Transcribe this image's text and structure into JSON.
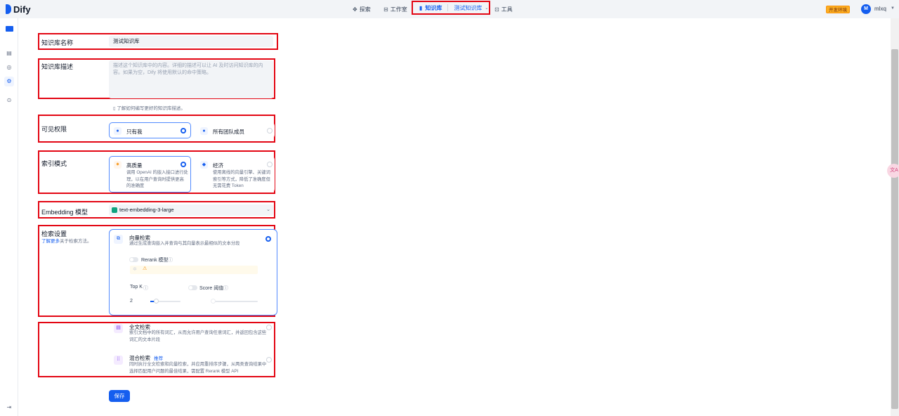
{
  "app": {
    "logo_text": "Dify"
  },
  "nav": {
    "explore": "探索",
    "studio": "工作室",
    "knowledge": "知识库",
    "dataset_name": "测试知识库",
    "tools": "工具"
  },
  "header": {
    "env_badge": "开发环境",
    "avatar_initial": "M",
    "username": "mlxq"
  },
  "form": {
    "name_label": "知识库名称",
    "name_value": "测试知识库",
    "desc_label": "知识库描述",
    "desc_placeholder": "描述这个知识库中的内容。详细的描述可以让 AI 及时访问知识库的内容。如果为空，Dify 将使用默认的命中策略。",
    "desc_hint": "了解如何编写更好的知识库描述。",
    "permission_label": "可见权限",
    "permission_options": [
      "只有我",
      "所有团队成员"
    ],
    "index_label": "索引模式",
    "index_options": [
      {
        "title": "高质量",
        "desc": "调用 OpenAI 的嵌入接口进行处理，以在用户查询时提供更高的准确度"
      },
      {
        "title": "经济",
        "desc": "使用离线的向量引擎、关键词索引等方式，降低了准确度但无需花费 Token"
      }
    ],
    "embedding_label": "Embedding 模型",
    "embedding_value": "text-embedding-3-large",
    "retrieval_label": "检索设置",
    "retrieval_link": "了解更多",
    "retrieval_link_suffix": "关于检索方法。",
    "retrieval_options": [
      {
        "title": "向量检索",
        "desc": "通过生成查询嵌入并查询与其向量表示最相似的文本分段"
      },
      {
        "title": "全文检索",
        "desc": "索引文档中的所有词汇，从而允许用户查询任意词汇，并返回包含这些词汇的文本片段"
      },
      {
        "title": "混合检索",
        "badge": "推荐",
        "desc": "同时执行全文检索和向量检索，并应用重排序步骤，从两类查询结果中选择匹配用户问题的最佳结果，需配置 Rerank 模型 API"
      }
    ],
    "rerank_label": "Rerank 模型",
    "topk_label": "Top K",
    "topk_value": "2",
    "score_label": "Score 阈值",
    "save_label": "保存"
  },
  "colors": {
    "accent": "#155eef",
    "highlight_box": "#e30613"
  }
}
